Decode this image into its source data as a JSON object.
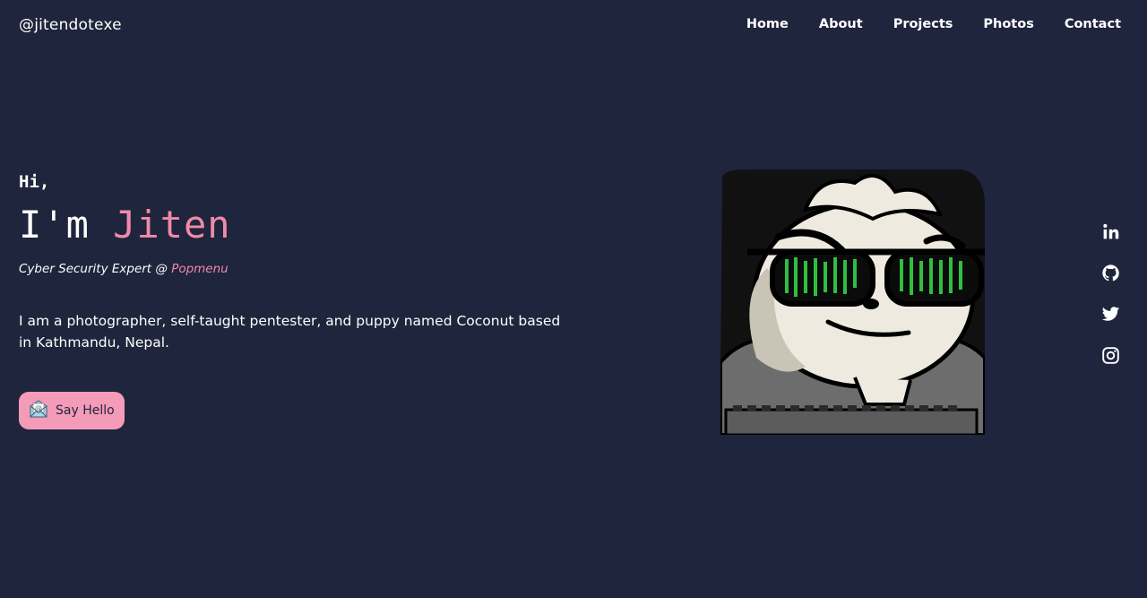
{
  "brand": {
    "handle": "@jitendotexe"
  },
  "nav": {
    "items": [
      {
        "label": "Home"
      },
      {
        "label": "About"
      },
      {
        "label": "Projects"
      },
      {
        "label": "Photos"
      },
      {
        "label": "Contact"
      }
    ]
  },
  "hero": {
    "greeting": "Hi,",
    "intro_prefix": "I'm ",
    "name": "Jiten",
    "role_prefix": "Cyber Security Expert @ ",
    "company": "Popmenu",
    "bio": "I am a photographer, self-taught pentester, and puppy named Coconut based in Kathmandu, Nepal.",
    "cta_label": "Say Hello",
    "cta_icon": "envelope-at-icon"
  },
  "avatar": {
    "subject": "panda-hacker-sunglasses"
  },
  "social": {
    "items": [
      {
        "icon": "linkedin-icon"
      },
      {
        "icon": "github-icon"
      },
      {
        "icon": "twitter-icon"
      },
      {
        "icon": "instagram-icon"
      }
    ]
  },
  "colors": {
    "background": "#1e253c",
    "accent": "#f08aa8",
    "button": "#f39bb8",
    "text": "#ffffff"
  }
}
